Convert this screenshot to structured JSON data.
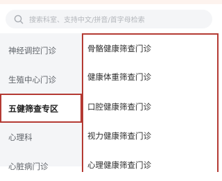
{
  "search": {
    "placeholder": "搜索科室、支持中文/拼音/首字母检索"
  },
  "sidebar": {
    "items": [
      {
        "label": "神经调控门诊",
        "selected": false
      },
      {
        "label": "生殖中心门诊",
        "selected": false
      },
      {
        "label": "五健筛查专区",
        "selected": true
      },
      {
        "label": "心理科",
        "selected": false
      },
      {
        "label": "心脏病门诊",
        "selected": false
      }
    ]
  },
  "clinics": [
    {
      "label": "骨骼健康筛查门诊"
    },
    {
      "label": "健康体重筛查门诊"
    },
    {
      "label": "口腔健康筛查门诊"
    },
    {
      "label": "视力健康筛查门诊"
    },
    {
      "label": "心理健康筛查门诊"
    }
  ],
  "colors": {
    "highlight_border": "#b43a33",
    "sidebar_bg": "#f4f5f7",
    "top_strip": "#fdf3ee"
  }
}
